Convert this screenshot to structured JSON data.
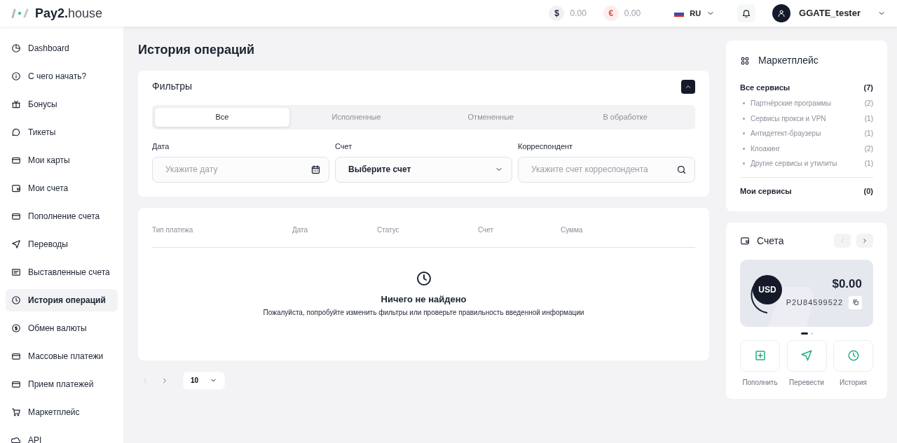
{
  "header": {
    "logo_bold": "Pay2.",
    "logo_light": "house",
    "balances": [
      {
        "symbol": "$",
        "amount": "0.00",
        "color": "#1b2232"
      },
      {
        "symbol": "€",
        "amount": "0.00",
        "color": "#d9534f"
      }
    ],
    "language": "RU",
    "user": "GGATE_tester"
  },
  "sidebar": {
    "items": [
      {
        "label": "Dashboard",
        "selected": false
      },
      {
        "label": "С чего начать?",
        "selected": false
      },
      {
        "label": "Бонусы",
        "selected": false
      },
      {
        "label": "Тикеты",
        "selected": false
      },
      {
        "label": "Мои карты",
        "selected": false
      },
      {
        "label": "Мои счета",
        "selected": false
      },
      {
        "label": "Пополнение счета",
        "selected": false
      },
      {
        "label": "Переводы",
        "selected": false
      },
      {
        "label": "Выставленные счета",
        "selected": false
      },
      {
        "label": "История операций",
        "selected": true
      },
      {
        "label": "Обмен валюты",
        "selected": false
      },
      {
        "label": "Массовые платежи",
        "selected": false
      },
      {
        "label": "Прием платежей",
        "selected": false
      },
      {
        "label": "Маркетплейс",
        "selected": false
      },
      {
        "label": "API",
        "selected": false
      }
    ]
  },
  "page_title": "История операций",
  "filters": {
    "title": "Фильтры",
    "expanded": true,
    "tabs": [
      {
        "label": "Все",
        "selected": true
      },
      {
        "label": "Исполненные",
        "selected": false
      },
      {
        "label": "Отмененные",
        "selected": false
      },
      {
        "label": "В обработке",
        "selected": false
      }
    ],
    "date": {
      "label": "Дата",
      "placeholder": "Укажите дату"
    },
    "account": {
      "label": "Счет",
      "value": "Выберите счет"
    },
    "correspondent": {
      "label": "Корреспондент",
      "placeholder": "Укажите счет корреспондента"
    }
  },
  "table": {
    "columns": [
      "Тип платежа",
      "Дата",
      "Статус",
      "Счет",
      "Сумма"
    ],
    "empty_title": "Ничего не найдено",
    "empty_text": "Пожалуйста, попробуйте изменить фильтры или проверьте правильность введенной информации"
  },
  "pagination": {
    "prev_disabled": true,
    "next_disabled": false,
    "page_size": "10"
  },
  "marketplace": {
    "title": "Маркетплейс",
    "all": {
      "label": "Все сервисы",
      "count": "(7)"
    },
    "categories": [
      {
        "label": "Партнёрские программы",
        "count": "(2)"
      },
      {
        "label": "Сервисы прокси и VPN",
        "count": "(1)"
      },
      {
        "label": "Антидетект-браузеры",
        "count": "(1)"
      },
      {
        "label": "Клоакинг",
        "count": "(2)"
      },
      {
        "label": "Другие сервисы и утилиты",
        "count": "(1)"
      }
    ],
    "mine": {
      "label": "Мои сервисы",
      "count": "(0)"
    }
  },
  "accounts": {
    "title": "Счета",
    "prev_disabled": true,
    "next_disabled": false,
    "card": {
      "currency": "USD",
      "balance": "$0.00",
      "number": "P2U84599522"
    },
    "dots": [
      {
        "selected": true
      },
      {
        "selected": false
      }
    ],
    "actions": [
      {
        "label": "Пополнить",
        "kind": "plus"
      },
      {
        "label": "Перевести",
        "kind": "send"
      },
      {
        "label": "История",
        "kind": "clock"
      }
    ]
  }
}
